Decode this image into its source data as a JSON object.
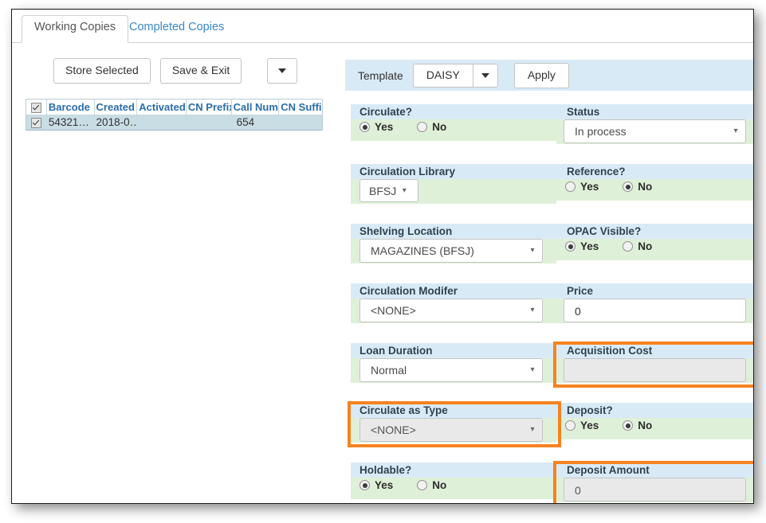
{
  "tabs": [
    {
      "label": "Working Copies",
      "active": true
    },
    {
      "label": "Completed Copies",
      "active": false
    }
  ],
  "toolbar": {
    "store_selected_label": "Store Selected",
    "save_exit_label": "Save & Exit",
    "more_caret_icon": "chevron-down-icon"
  },
  "grid": {
    "select_all_checked": true,
    "columns": [
      {
        "key": "check",
        "label": ""
      },
      {
        "key": "barcode",
        "label": "Barcode"
      },
      {
        "key": "created",
        "label": "Created"
      },
      {
        "key": "activated",
        "label": "Activated"
      },
      {
        "key": "cn_prefix",
        "label": "CN Prefix"
      },
      {
        "key": "call_num",
        "label": "Call Num"
      },
      {
        "key": "cn_suffix",
        "label": "CN Suffix"
      }
    ],
    "rows": [
      {
        "checked": true,
        "barcode": "54321…",
        "created": "2018-0…",
        "activated": "",
        "cn_prefix": "",
        "call_num": "654",
        "cn_suffix": ""
      }
    ]
  },
  "template_bar": {
    "label": "Template",
    "value": "DAISY",
    "dropdown_icon": "chevron-down-icon",
    "apply_label": "Apply"
  },
  "form": {
    "rows": [
      {
        "left": {
          "label": "Circulate?",
          "type": "radio",
          "options": [
            "Yes",
            "No"
          ],
          "selected": "Yes"
        },
        "right": {
          "label": "Status",
          "type": "select",
          "value": "In process",
          "disabled": false
        }
      },
      {
        "left": {
          "label": "Circulation Library",
          "type": "select-small",
          "value": "BFSJ",
          "disabled": false
        },
        "right": {
          "label": "Reference?",
          "type": "radio",
          "options": [
            "Yes",
            "No"
          ],
          "selected": "No"
        }
      },
      {
        "left": {
          "label": "Shelving Location",
          "type": "select",
          "value": "MAGAZINES (BFSJ)",
          "disabled": false
        },
        "right": {
          "label": "OPAC Visible?",
          "type": "radio",
          "options": [
            "Yes",
            "No"
          ],
          "selected": "Yes"
        }
      },
      {
        "left": {
          "label": "Circulation Modifer",
          "type": "select",
          "value": "<NONE>",
          "disabled": false
        },
        "right": {
          "label": "Price",
          "type": "text",
          "value": "0",
          "disabled": false
        }
      },
      {
        "left": {
          "label": "Loan Duration",
          "type": "select",
          "value": "Normal",
          "disabled": false
        },
        "right": {
          "label": "Acquisition Cost",
          "type": "text",
          "value": "",
          "disabled": true,
          "highlighted": true
        }
      },
      {
        "left": {
          "label": "Circulate as Type",
          "type": "select",
          "value": "<NONE>",
          "disabled": true,
          "highlighted": true
        },
        "right": {
          "label": "Deposit?",
          "type": "radio",
          "options": [
            "Yes",
            "No"
          ],
          "selected": "No"
        }
      },
      {
        "left": {
          "label": "Holdable?",
          "type": "radio",
          "options": [
            "Yes",
            "No"
          ],
          "selected": "Yes"
        },
        "right": {
          "label": "Deposit Amount",
          "type": "text",
          "value": "0",
          "disabled": true,
          "highlighted": true
        }
      }
    ]
  },
  "colors": {
    "header_band": "#d9eaf7",
    "value_band": "#dff0d8",
    "highlight": "#f5831f",
    "grid_row": "#c9dde4",
    "link": "#3a87c8",
    "column_header_text": "#2a6ea8"
  }
}
